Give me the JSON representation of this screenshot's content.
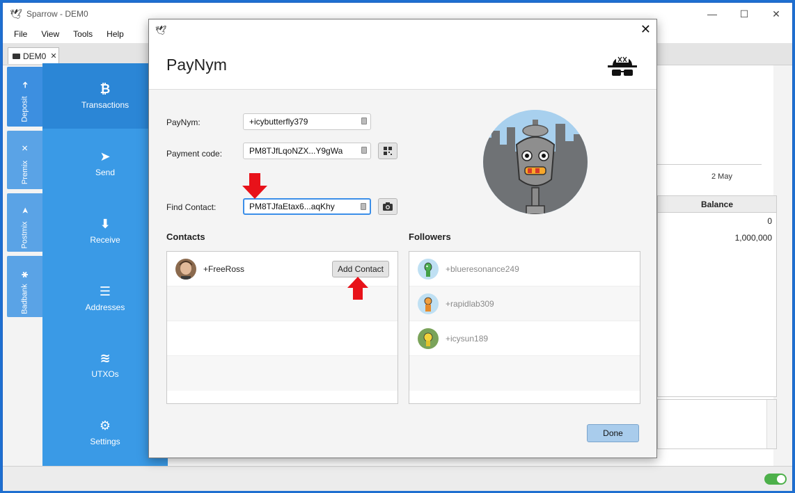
{
  "app": {
    "title": "Sparrow - DEM0",
    "menu": [
      "File",
      "View",
      "Tools",
      "Help"
    ],
    "wallet_tab": "DEM0",
    "accounts": [
      "Deposit",
      "Premix",
      "Postmix",
      "Badbank"
    ],
    "nav": [
      "Transactions",
      "Send",
      "Receive",
      "Addresses",
      "UTXOs",
      "Settings"
    ],
    "chart_date": "2 May",
    "table": {
      "header": "Balance",
      "values": [
        "0",
        "1,000,000"
      ]
    }
  },
  "dialog": {
    "title": "PayNym",
    "paynym_label": "PayNym:",
    "paynym_value": "+icybutterfly379",
    "payment_code_label": "Payment code:",
    "payment_code_value": "PM8TJfLqoNZX...Y9gWa",
    "find_contact_label": "Find Contact:",
    "find_contact_value": "PM8TJfaEtax6...aqKhy",
    "contacts_title": "Contacts",
    "followers_title": "Followers",
    "contacts": [
      {
        "name": "+FreeRoss",
        "action": "Add Contact"
      }
    ],
    "followers": [
      {
        "name": "+blueresonance249"
      },
      {
        "name": "+rapidlab309"
      },
      {
        "name": "+icysun189"
      }
    ],
    "done_label": "Done"
  },
  "colors": {
    "accent_blue": "#3a9ae6",
    "nav_active": "#2b86d6",
    "annotation_arrow": "#e8121a",
    "done_button": "#a9ccec"
  }
}
